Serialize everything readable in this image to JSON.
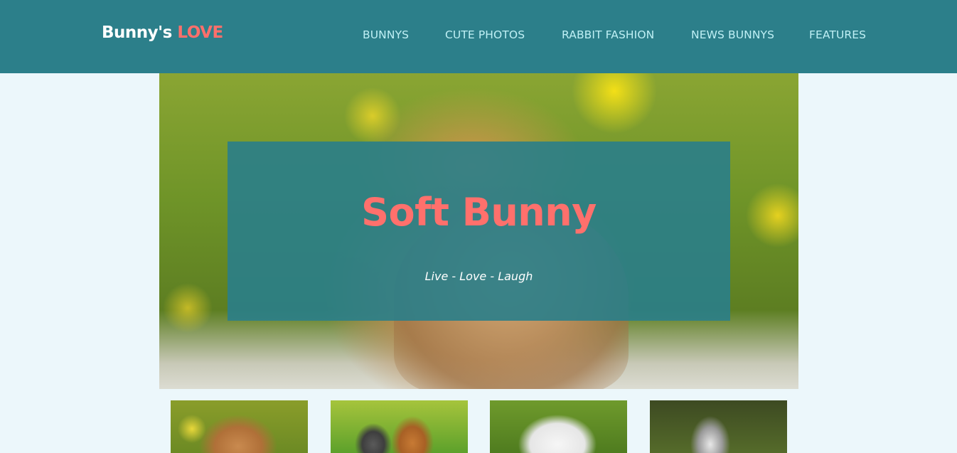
{
  "brand": {
    "name_part1": "Bunny's",
    "name_part2": "LOVE"
  },
  "nav": {
    "items": [
      {
        "label": "BUNNYS"
      },
      {
        "label": "CUTE PHOTOS"
      },
      {
        "label": "RABBIT FASHION"
      },
      {
        "label": "NEWS BUNNYS"
      },
      {
        "label": "FEATURES"
      }
    ]
  },
  "hero": {
    "title": "Soft Bunny",
    "subtitle": "Live - Love - Laugh"
  },
  "colors": {
    "header_bg": "#2c7f8a",
    "page_bg": "#ecf7fb",
    "accent": "#ff706c",
    "nav_text": "#bff0f5"
  }
}
